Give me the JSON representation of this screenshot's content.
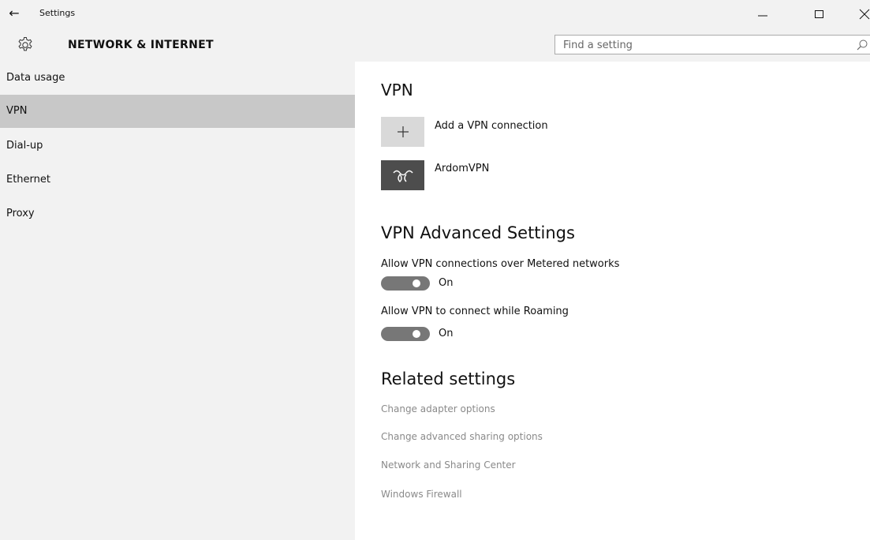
{
  "window": {
    "title": "Settings",
    "back_glyph": "←",
    "min_glyph": "—",
    "max_glyph": "☐",
    "close_glyph": "✕"
  },
  "header": {
    "icon": "gear-icon",
    "section_title": "NETWORK & INTERNET",
    "search": {
      "placeholder": "Find a setting",
      "value": "",
      "icon": "search-icon"
    }
  },
  "sidebar": {
    "items": [
      {
        "label": "Data usage",
        "selected": false
      },
      {
        "label": "VPN",
        "selected": true
      },
      {
        "label": "Dial-up",
        "selected": false
      },
      {
        "label": "Ethernet",
        "selected": false
      },
      {
        "label": "Proxy",
        "selected": false
      }
    ]
  },
  "main": {
    "vpn_heading": "VPN",
    "add_vpn": {
      "label": "Add a VPN connection",
      "icon": "plus-icon",
      "glyph": "+"
    },
    "vpn_connections": [
      {
        "label": "ArdomVPN",
        "icon": "vpn-logo-icon"
      }
    ],
    "advanced_heading": "VPN Advanced Settings",
    "settings": [
      {
        "label": "Allow VPN connections over Metered networks",
        "state": "On",
        "on": true
      },
      {
        "label": "Allow VPN to connect while Roaming",
        "state": "On",
        "on": true
      }
    ],
    "related_heading": "Related settings",
    "related_links": [
      "Change adapter options",
      "Change advanced sharing options",
      "Network and Sharing Center",
      "Windows Firewall"
    ]
  },
  "colors": {
    "sidebar_bg": "#f2f2f2",
    "selected_bg": "#c8c8c8",
    "toggle_on": "#777777",
    "link": "#8a8a8a"
  }
}
